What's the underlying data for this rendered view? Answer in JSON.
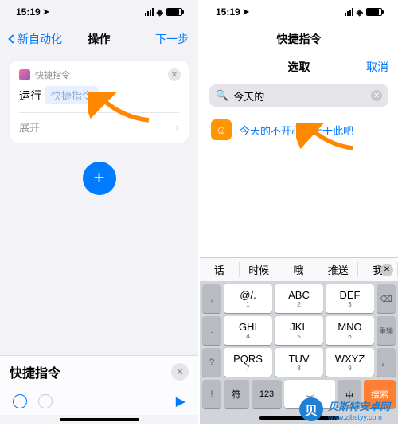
{
  "status": {
    "time": "15:19",
    "loc_icon": "➤"
  },
  "left": {
    "nav": {
      "back": "新自动化",
      "title": "操作",
      "next": "下一步"
    },
    "card": {
      "header": "快捷指令",
      "action": "运行",
      "pill": "快捷指令",
      "expand": "展开"
    },
    "bottom": {
      "label": "快捷指令"
    }
  },
  "right": {
    "nav": {
      "title": "快捷指令",
      "subtitle": "选取",
      "cancel": "取消"
    },
    "search": {
      "value": "今天的"
    },
    "result": {
      "text": "今天的不开心就止于此吧"
    },
    "suggestions": [
      "话",
      "时候",
      "哦",
      "推送",
      "我"
    ],
    "keys": {
      "r1": [
        {
          "m": "@/.",
          "s": "1"
        },
        {
          "m": "ABC",
          "s": "2"
        },
        {
          "m": "DEF",
          "s": "3"
        }
      ],
      "r2": [
        {
          "m": "GHI",
          "s": "4"
        },
        {
          "m": "JKL",
          "s": "5"
        },
        {
          "m": "MNO",
          "s": "6"
        }
      ],
      "r3": [
        {
          "m": "PQRS",
          "s": "7"
        },
        {
          "m": "TUV",
          "s": "8"
        },
        {
          "m": "WXYZ",
          "s": "9"
        }
      ],
      "side_left": [
        ",",
        ".",
        "?",
        "!"
      ],
      "side_right": [
        "⌫",
        "重输",
        "。"
      ],
      "r4": [
        "符",
        "123",
        "",
        "中",
        "搜索"
      ]
    }
  },
  "watermark": {
    "cn": "贝斯特安卓网",
    "en": "www.zjbstyy.com",
    "icon": "贝"
  }
}
